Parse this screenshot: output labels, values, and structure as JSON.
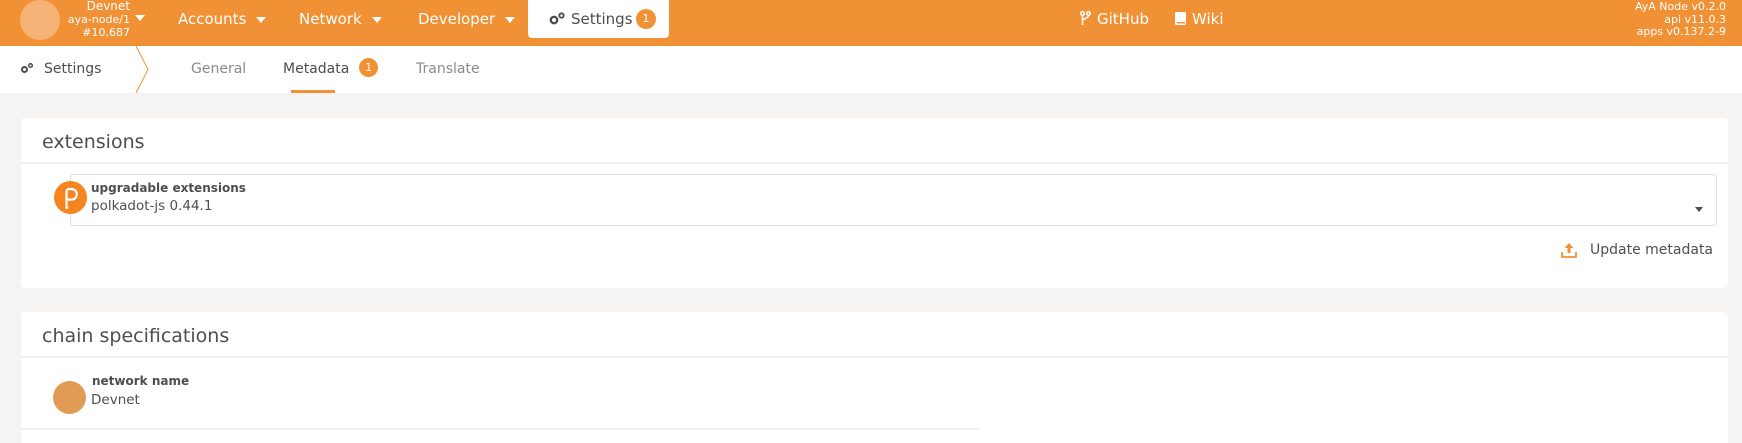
{
  "chain": {
    "name": "Devnet",
    "node": "aya-node/1",
    "block": "#10,687"
  },
  "nav": {
    "accounts": "Accounts",
    "network": "Network",
    "developer": "Developer",
    "settings": "Settings",
    "settings_badge": "1",
    "github": "GitHub",
    "wiki": "Wiki"
  },
  "version": {
    "node": "AyA Node v0.2.0",
    "api": "api v11.0.3",
    "apps": "apps v0.137.2-9"
  },
  "subnav": {
    "title": "Settings",
    "tabs": [
      {
        "label": "General"
      },
      {
        "label": "Metadata",
        "badge": "1"
      },
      {
        "label": "Translate"
      }
    ]
  },
  "extensions": {
    "heading": "extensions",
    "dropdown_label": "upgradable extensions",
    "dropdown_value": "polkadot-js 0.44.1",
    "update_button": "Update metadata"
  },
  "chain_specs": {
    "heading": "chain specifications",
    "network_label": "network name",
    "network_value": "Devnet"
  },
  "colors": {
    "accent": "#f19135",
    "background": "#f5f4f3",
    "polkadot": "#f5851e"
  },
  "icons": [
    "chevron-down-icon",
    "gears-icon",
    "branch-icon",
    "book-icon",
    "upload-icon",
    "polkadot-logo"
  ]
}
